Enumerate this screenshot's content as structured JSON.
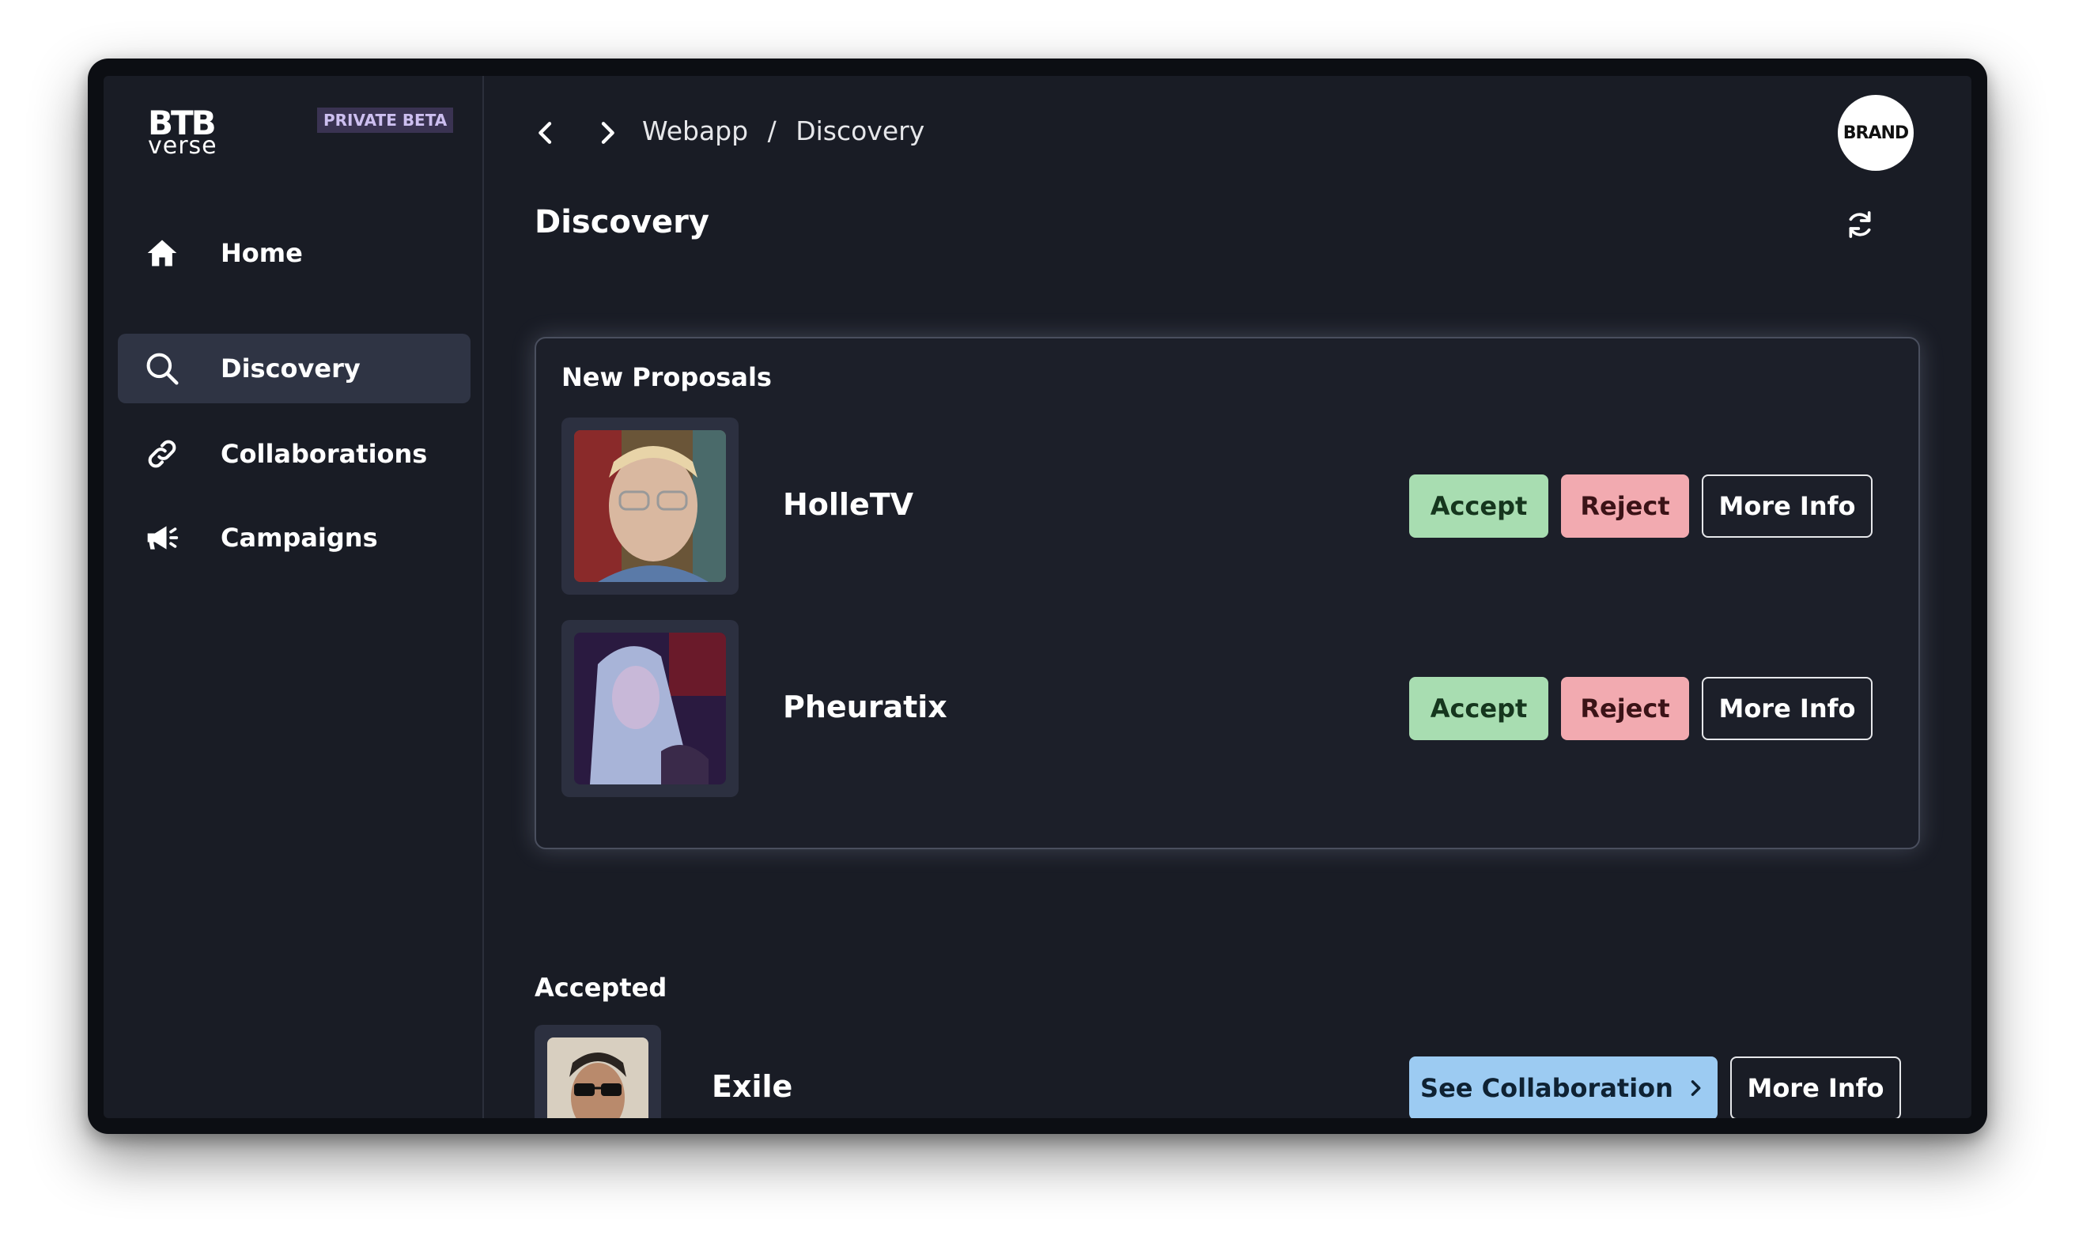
{
  "sidebar": {
    "logo_top": "BTB",
    "logo_bottom": "verse",
    "badge": "PRIVATE BETA",
    "items": [
      {
        "label": "Home",
        "icon": "home-icon",
        "active": false
      },
      {
        "label": "Discovery",
        "icon": "search-icon",
        "active": true
      },
      {
        "label": "Collaborations",
        "icon": "link-icon",
        "active": false
      },
      {
        "label": "Campaigns",
        "icon": "megaphone-icon",
        "active": false
      }
    ]
  },
  "header": {
    "breadcrumb": [
      "Webapp",
      "Discovery"
    ],
    "breadcrumb_sep": "/",
    "avatar_text": "BRAND"
  },
  "page": {
    "title": "Discovery"
  },
  "proposals": {
    "title": "New Proposals",
    "items": [
      {
        "name": "HolleTV",
        "accept": "Accept",
        "reject": "Reject",
        "info": "More Info"
      },
      {
        "name": "Pheuratix",
        "accept": "Accept",
        "reject": "Reject",
        "info": "More Info"
      }
    ]
  },
  "accepted": {
    "title": "Accepted",
    "items": [
      {
        "name": "Exile",
        "see": "See Collaboration",
        "info": "More Info"
      }
    ]
  },
  "colors": {
    "background": "#191c25",
    "accept": "#a8ddb1",
    "reject": "#f2aab0",
    "see_collaboration": "#9ccbf2",
    "badge": "#3a3352"
  }
}
